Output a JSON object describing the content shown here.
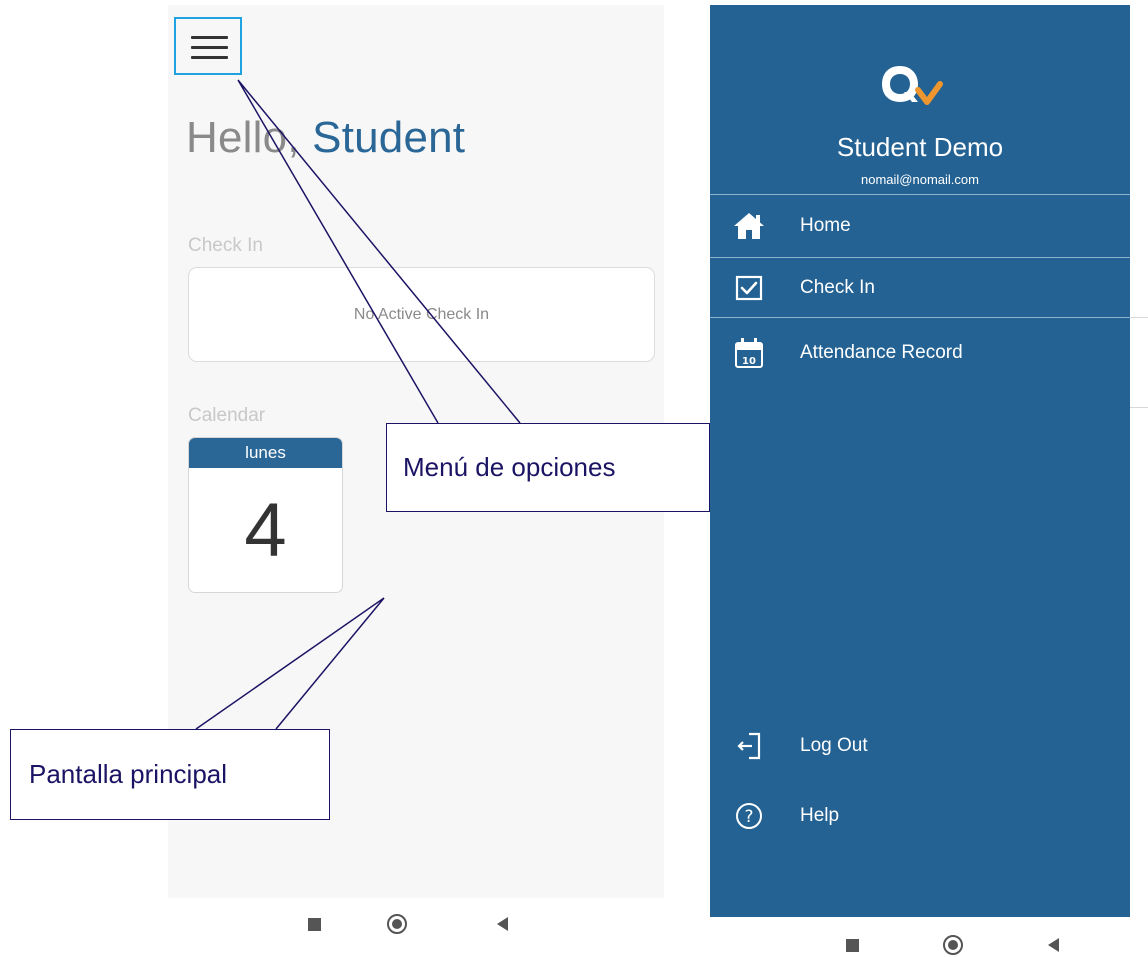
{
  "left_screen": {
    "greeting_hello": "Hello,",
    "greeting_name": "Student",
    "checkin_label": "Check In",
    "checkin_status": "No Active Check In",
    "calendar_label": "Calendar",
    "calendar_day": "lunes",
    "calendar_date": "4",
    "menu_icon": "hamburger-menu-icon"
  },
  "drawer": {
    "user_name": "Student Demo",
    "user_email": "nomail@nomail.com",
    "items": [
      {
        "label": "Home",
        "icon": "home-icon"
      },
      {
        "label": "Check In",
        "icon": "checkbox-icon"
      },
      {
        "label": "Attendance Record",
        "icon": "calendar-icon"
      }
    ],
    "bottom_items": [
      {
        "label": "Log Out",
        "icon": "logout-icon"
      },
      {
        "label": "Help",
        "icon": "help-icon"
      }
    ],
    "logo_icon": "q-logo-icon"
  },
  "annotations": {
    "menu_callout": "Menú de opciones",
    "screen_callout": "Pantalla principal"
  },
  "colors": {
    "primary": "#236293",
    "accent_text": "#2a6796",
    "logo_accent": "#f0962f",
    "highlight_border": "#1fa3e0",
    "callout": "#1b1464"
  }
}
